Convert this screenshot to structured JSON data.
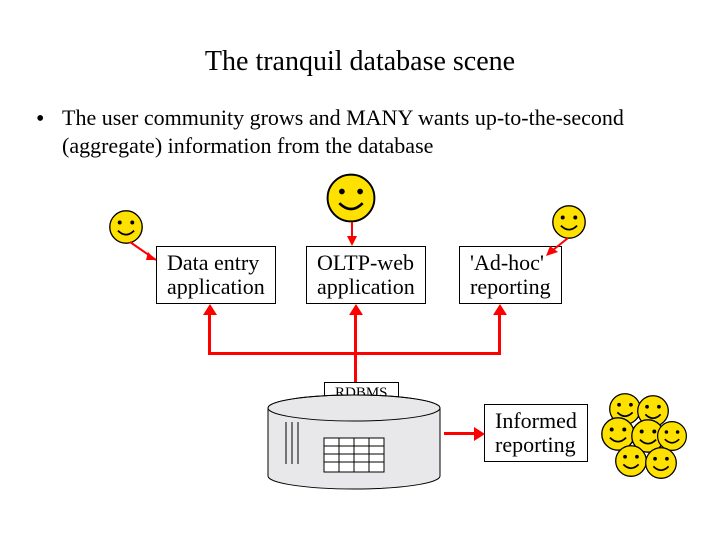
{
  "title": "The tranquil database scene",
  "bullet": "The user community grows and MANY wants up-to-the-second (aggregate) information from the database",
  "boxes": {
    "data_entry": "Data entry\napplication",
    "oltp": "OLTP-web\napplication",
    "adhoc": "'Ad-hoc'\nreporting",
    "rdbms": "RDBMS",
    "informed": "Informed\nreporting"
  }
}
